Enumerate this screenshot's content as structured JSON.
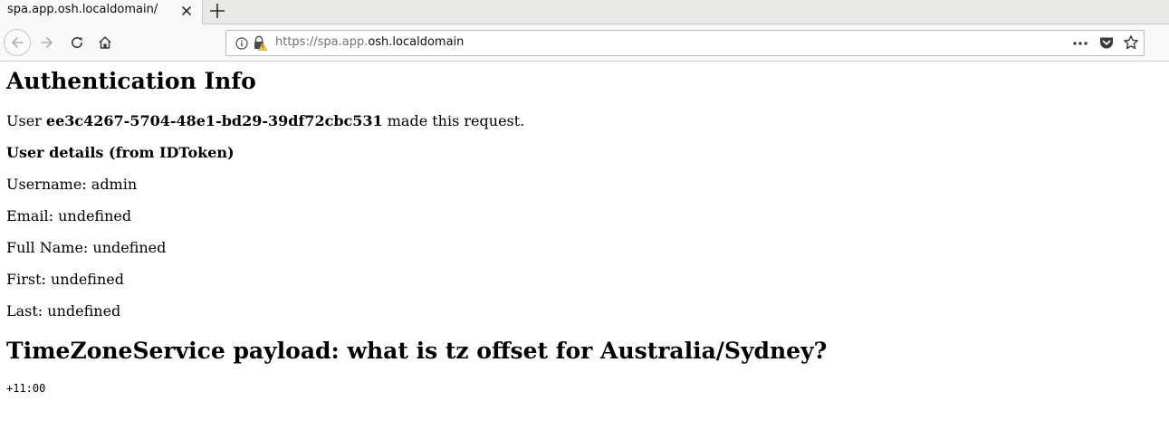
{
  "browser": {
    "tab_title": "spa.app.osh.localdomain/",
    "url_prefix": "https://spa.app.",
    "url_host": "osh.localdomain"
  },
  "page": {
    "title": "Authentication Info",
    "user_prefix": "User ",
    "user_id": "ee3c4267-5704-48e1-bd29-39df72cbc531",
    "user_suffix": " made this request.",
    "details_heading": "User details (from IDToken)",
    "username": "Username: admin",
    "email": "Email: undefined",
    "full_name": "Full Name: undefined",
    "first": "First: undefined",
    "last": "Last: undefined",
    "tz_heading": "TimeZoneService payload: what is tz offset for Australia/Sydney?",
    "tz_value": "+11:00"
  },
  "icons": {
    "tab_close": "close-icon",
    "new_tab": "plus-icon",
    "back": "arrow-left-icon",
    "forward": "arrow-right-icon",
    "reload": "reload-icon",
    "home": "home-icon",
    "info": "info-icon",
    "lock_warning": "lock-warning-icon",
    "more": "more-icon",
    "pocket": "pocket-icon",
    "bookmark": "star-icon"
  }
}
